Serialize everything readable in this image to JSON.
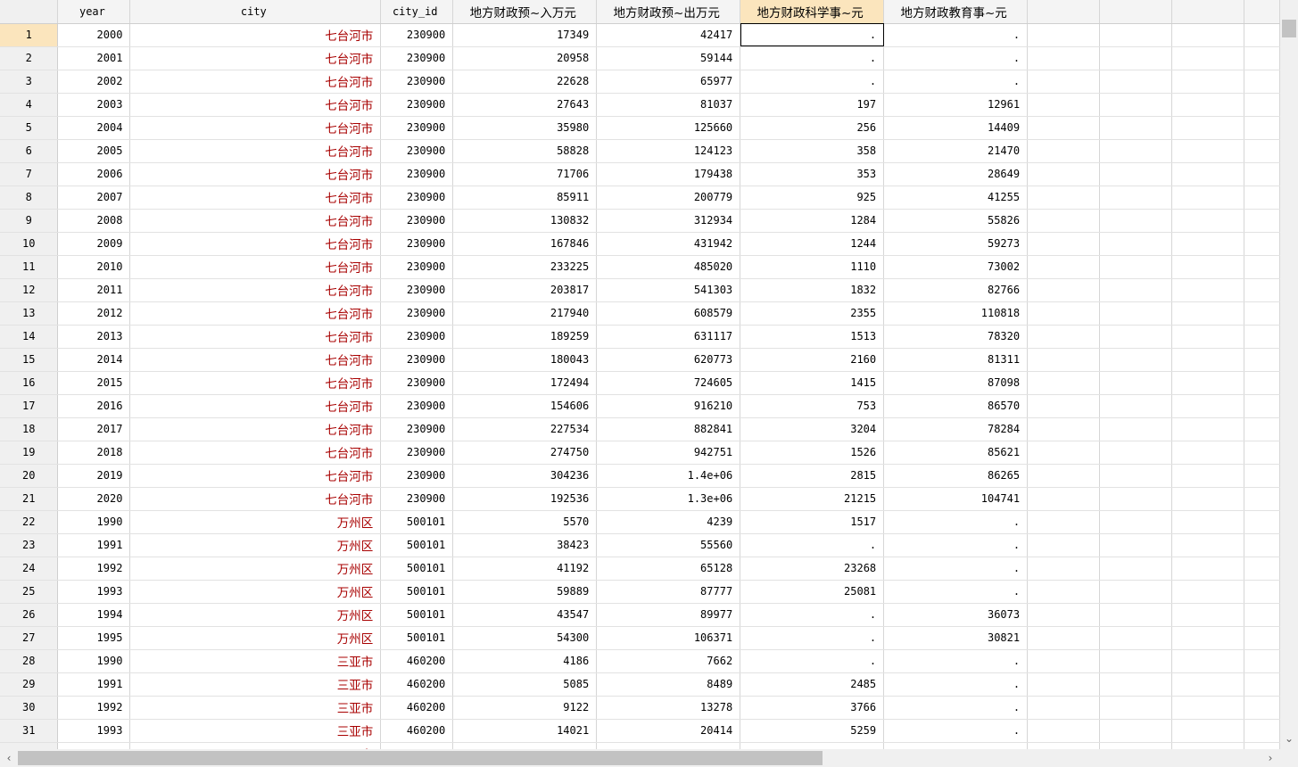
{
  "grid": {
    "columns": [
      {
        "label": "year",
        "width": 81,
        "kind": "num"
      },
      {
        "label": "city",
        "width": 281,
        "kind": "str"
      },
      {
        "label": "city_id",
        "width": 81,
        "kind": "num"
      },
      {
        "label": "地方财政预~入万元",
        "width": 161,
        "kind": "num"
      },
      {
        "label": "地方财政预~出万元",
        "width": 161,
        "kind": "num"
      },
      {
        "label": "地方财政科学事~元",
        "width": 161,
        "kind": "num"
      },
      {
        "label": "地方财政教育事~元",
        "width": 161,
        "kind": "num"
      },
      {
        "label": "",
        "width": 81,
        "kind": "num"
      },
      {
        "label": "",
        "width": 81,
        "kind": "num"
      },
      {
        "label": "",
        "width": 81,
        "kind": "num"
      },
      {
        "label": "",
        "width": 40,
        "kind": "num"
      }
    ],
    "selected_column": 5,
    "selected_row": 0,
    "rows": [
      [
        "2000",
        "七台河市",
        "230900",
        "17349",
        "42417",
        ".",
        "."
      ],
      [
        "2001",
        "七台河市",
        "230900",
        "20958",
        "59144",
        ".",
        "."
      ],
      [
        "2002",
        "七台河市",
        "230900",
        "22628",
        "65977",
        ".",
        "."
      ],
      [
        "2003",
        "七台河市",
        "230900",
        "27643",
        "81037",
        "197",
        "12961"
      ],
      [
        "2004",
        "七台河市",
        "230900",
        "35980",
        "125660",
        "256",
        "14409"
      ],
      [
        "2005",
        "七台河市",
        "230900",
        "58828",
        "124123",
        "358",
        "21470"
      ],
      [
        "2006",
        "七台河市",
        "230900",
        "71706",
        "179438",
        "353",
        "28649"
      ],
      [
        "2007",
        "七台河市",
        "230900",
        "85911",
        "200779",
        "925",
        "41255"
      ],
      [
        "2008",
        "七台河市",
        "230900",
        "130832",
        "312934",
        "1284",
        "55826"
      ],
      [
        "2009",
        "七台河市",
        "230900",
        "167846",
        "431942",
        "1244",
        "59273"
      ],
      [
        "2010",
        "七台河市",
        "230900",
        "233225",
        "485020",
        "1110",
        "73002"
      ],
      [
        "2011",
        "七台河市",
        "230900",
        "203817",
        "541303",
        "1832",
        "82766"
      ],
      [
        "2012",
        "七台河市",
        "230900",
        "217940",
        "608579",
        "2355",
        "110818"
      ],
      [
        "2013",
        "七台河市",
        "230900",
        "189259",
        "631117",
        "1513",
        "78320"
      ],
      [
        "2014",
        "七台河市",
        "230900",
        "180043",
        "620773",
        "2160",
        "81311"
      ],
      [
        "2015",
        "七台河市",
        "230900",
        "172494",
        "724605",
        "1415",
        "87098"
      ],
      [
        "2016",
        "七台河市",
        "230900",
        "154606",
        "916210",
        "753",
        "86570"
      ],
      [
        "2017",
        "七台河市",
        "230900",
        "227534",
        "882841",
        "3204",
        "78284"
      ],
      [
        "2018",
        "七台河市",
        "230900",
        "274750",
        "942751",
        "1526",
        "85621"
      ],
      [
        "2019",
        "七台河市",
        "230900",
        "304236",
        "1.4e+06",
        "2815",
        "86265"
      ],
      [
        "2020",
        "七台河市",
        "230900",
        "192536",
        "1.3e+06",
        "21215",
        "104741"
      ],
      [
        "1990",
        "万州区",
        "500101",
        "5570",
        "4239",
        "1517",
        "."
      ],
      [
        "1991",
        "万州区",
        "500101",
        "38423",
        "55560",
        ".",
        "."
      ],
      [
        "1992",
        "万州区",
        "500101",
        "41192",
        "65128",
        "23268",
        "."
      ],
      [
        "1993",
        "万州区",
        "500101",
        "59889",
        "87777",
        "25081",
        "."
      ],
      [
        "1994",
        "万州区",
        "500101",
        "43547",
        "89977",
        ".",
        "36073"
      ],
      [
        "1995",
        "万州区",
        "500101",
        "54300",
        "106371",
        ".",
        "30821"
      ],
      [
        "1990",
        "三亚市",
        "460200",
        "4186",
        "7662",
        ".",
        "."
      ],
      [
        "1991",
        "三亚市",
        "460200",
        "5085",
        "8489",
        "2485",
        "."
      ],
      [
        "1992",
        "三亚市",
        "460200",
        "9122",
        "13278",
        "3766",
        "."
      ],
      [
        "1993",
        "三亚市",
        "460200",
        "14021",
        "20414",
        "5259",
        "."
      ],
      [
        "",
        "三亚市",
        "",
        "",
        "",
        "",
        ""
      ]
    ]
  },
  "scrollbars": {
    "left_arrow": "‹",
    "right_arrow": "›",
    "down_arrow": "⌄"
  }
}
